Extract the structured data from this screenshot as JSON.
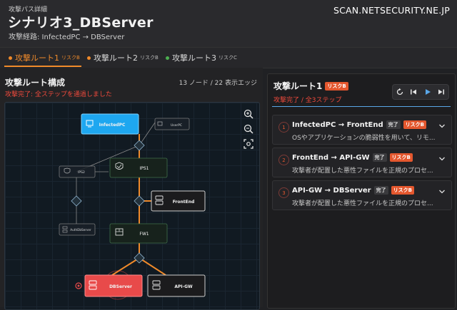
{
  "header": {
    "kicker": "攻撃パス詳細",
    "title": "シナリオ3_DBServer",
    "route": "攻撃経路: InfectedPC → DBServer",
    "site": "SCAN.NETSECURITY.NE.JP"
  },
  "tabs": [
    {
      "label": "攻撃ルート1",
      "risk": "リスクB",
      "dot": "#f08a2a"
    },
    {
      "label": "攻撃ルート2",
      "risk": "リスクB",
      "dot": "#f08a2a"
    },
    {
      "label": "攻撃ルート3",
      "risk": "リスクC",
      "dot": "#4caf50"
    }
  ],
  "graph": {
    "title": "攻撃ルート構成",
    "counts": "13 ノード / 22 表示エッジ",
    "status": "攻撃完了: 全ステップを通過しました",
    "nodes": {
      "infectedpc": "InfectedPC",
      "userpc": "UserPC",
      "ips2": "IPS2",
      "ips1": "IPS1",
      "frontend": "FrontEnd",
      "authdb": "AuthDbServer",
      "fw1": "FW1",
      "dbserver": "DBServer",
      "apigw": "API-GW"
    }
  },
  "panel": {
    "title": "攻撃ルート1",
    "risk": "リスクB",
    "status": "攻撃完了 / 全3ステップ",
    "steps": [
      {
        "num": "1",
        "title": "InfectedPC → FrontEnd",
        "done": "完了",
        "risk": "リスクB",
        "desc": "OSやアプリケーションの脆弱性を用いて、リモ..."
      },
      {
        "num": "2",
        "title": "FrontEnd → API-GW",
        "done": "完了",
        "risk": "リスクB",
        "desc": "攻撃者が配置した悪性ファイルを正規のプロセ..."
      },
      {
        "num": "3",
        "title": "API-GW → DBServer",
        "done": "完了",
        "risk": "リスクB",
        "desc": "攻撃者が配置した悪性ファイルを正規のプロセ..."
      }
    ]
  },
  "colors": {
    "accent": "#f08a2a",
    "risk": "#e4572e",
    "active_node": "#1ea7f0",
    "target_node": "#e84a4a",
    "link": "#5aa7e8"
  }
}
